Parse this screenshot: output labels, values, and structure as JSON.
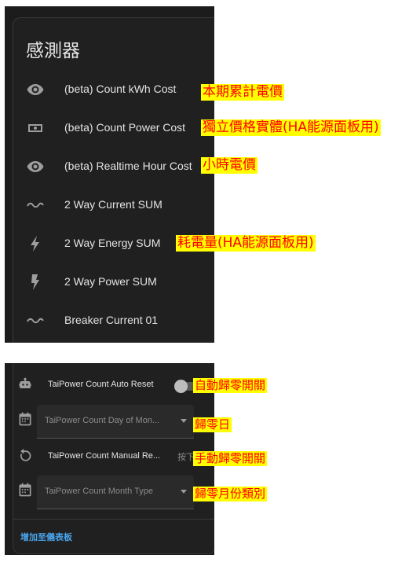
{
  "card_title": "感測器",
  "sensors": [
    {
      "icon": "eye-icon",
      "label": "(beta) Count kWh Cost",
      "annotation": "本期累計電價"
    },
    {
      "icon": "cash-icon",
      "label": "(beta) Count Power Cost",
      "annotation": "獨立價格實體(HA能源面板用)"
    },
    {
      "icon": "eye-icon",
      "label": "(beta) Realtime Hour Cost",
      "annotation": "小時電價"
    },
    {
      "icon": "current-ac-icon",
      "label": "2 Way Current SUM",
      "annotation": ""
    },
    {
      "icon": "flash-icon",
      "label": "2 Way Energy SUM",
      "annotation": "耗電量(HA能源面板用)"
    },
    {
      "icon": "flash-icon",
      "label": "2 Way Power SUM",
      "annotation": ""
    },
    {
      "icon": "current-ac-icon",
      "label": "Breaker Current 01",
      "annotation": ""
    }
  ],
  "config": [
    {
      "icon": "robot-icon",
      "label": "TaiPower Count Auto Reset",
      "control": "toggle",
      "annotation": "自動歸零開關"
    },
    {
      "icon": "calendar-icon",
      "label": "TaiPower Count Day of Mon...",
      "control": "select",
      "annotation": "歸零日"
    },
    {
      "icon": "restart-icon",
      "label": "TaiPower Count Manual Re...",
      "control": "button",
      "button_label": "按下",
      "annotation": "手動歸零開關"
    },
    {
      "icon": "calendar-icon",
      "label": "TaiPower Count Month Type",
      "control": "select",
      "annotation": "歸零月份類別"
    }
  ],
  "add_to_dashboard": "增加至儀表板"
}
